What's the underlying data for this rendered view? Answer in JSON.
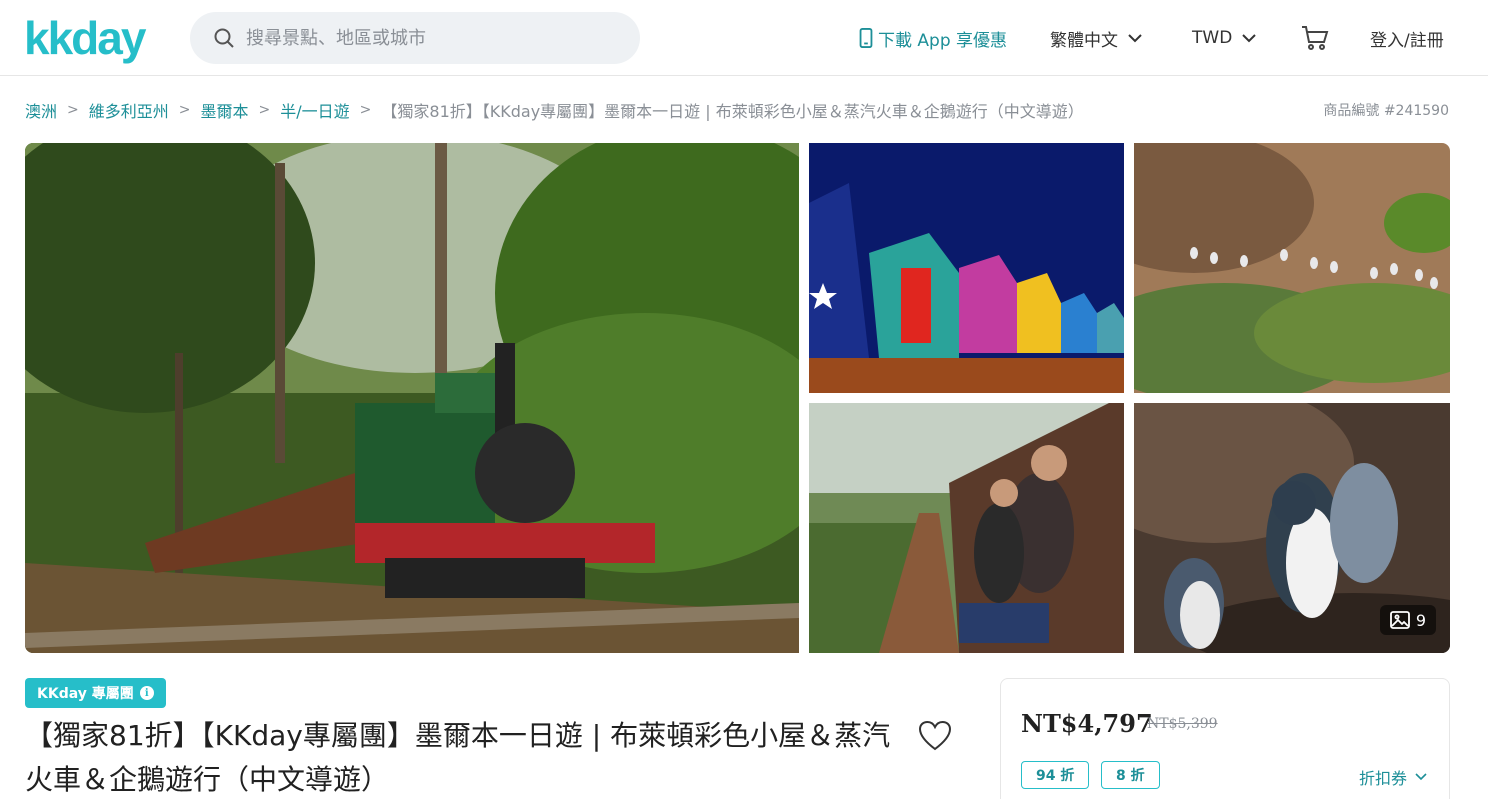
{
  "header": {
    "logo_text": "kkday",
    "search_placeholder": "搜尋景點、地區或城市",
    "download_app": "下載 App 享優惠",
    "language": "繁體中文",
    "currency": "TWD",
    "login": "登入/註冊"
  },
  "breadcrumb": {
    "items": [
      "澳洲",
      "維多利亞州",
      "墨爾本",
      "半/一日遊"
    ],
    "current": "【獨家81折】【KKday專屬團】墨爾本一日遊 | 布萊頓彩色小屋＆蒸汽火車＆企鵝遊行（中文導遊）"
  },
  "product_number": "商品編號 #241590",
  "gallery": {
    "photo_count": "9"
  },
  "product": {
    "badge": "KKday 專屬團",
    "badge_info_icon": "i",
    "title": "【獨家81折】【KKday專屬團】墨爾本一日遊 | 布萊頓彩色小屋＆蒸汽火車＆企鵝遊行（中文導遊）"
  },
  "price": {
    "current": "NT$4,797",
    "original": "NT$5,399",
    "discounts": [
      "94 折",
      "8 折"
    ],
    "coupon_label": "折扣券"
  },
  "colors": {
    "brand": "#26bec9",
    "link": "#1d8f98"
  }
}
